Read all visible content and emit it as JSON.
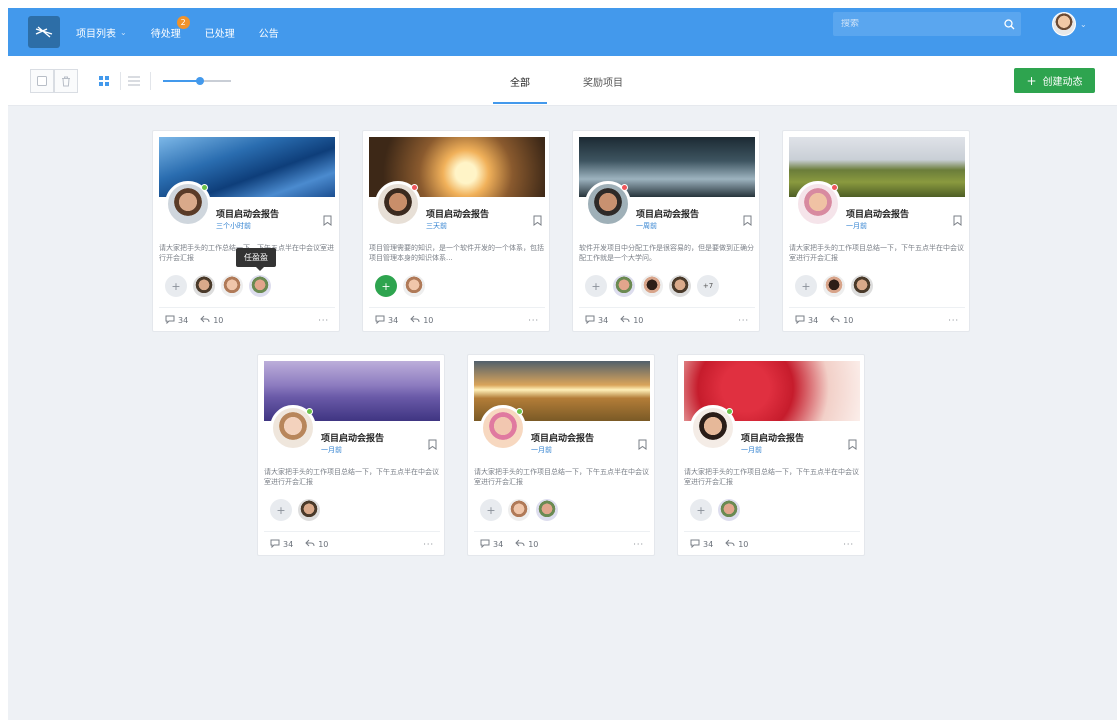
{
  "nav": {
    "items": [
      {
        "label": "项目列表",
        "caret": "⌄"
      },
      {
        "label": "待处理",
        "badge": "2"
      },
      {
        "label": "已处理"
      },
      {
        "label": "公告"
      }
    ],
    "search_placeholder": "搜索"
  },
  "toolbar": {
    "tabs": [
      {
        "label": "全部",
        "active": true
      },
      {
        "label": "奖励项目",
        "active": false
      }
    ],
    "slider_level": 0.55,
    "create_label": "创建动态",
    "create_plus": "+"
  },
  "colors": {
    "primary": "#4399ec",
    "green": "#2ea44f",
    "online": "#6cc24a",
    "busy": "#f0565b"
  },
  "cards": [
    {
      "title": "项目启动会报告",
      "time": "三个小时前",
      "desc": "请大家把手头的工作总结一下，下午五点半在中会议室进行开会汇报",
      "members": 3,
      "add_green": false,
      "comments": "34",
      "replies": "10",
      "more": "···",
      "status": "online"
    },
    {
      "title": "项目启动会报告",
      "time": "三天前",
      "desc": "项目管理需要的知识，是一个软件开发的一个体系，包括项目管理本身的知识体系...",
      "members": 1,
      "add_green": true,
      "comments": "34",
      "replies": "10",
      "more": "···",
      "status": "busy"
    },
    {
      "title": "项目启动会报告",
      "time": "一周前",
      "desc": "软件开发项目中分配工作是很容易的，但是要做到正确分配工作就是一个大学问。",
      "members": 3,
      "more_members": "+7",
      "add_green": false,
      "comments": "34",
      "replies": "10",
      "more": "···",
      "status": "busy"
    },
    {
      "title": "项目启动会报告",
      "time": "一月前",
      "desc": "请大家把手头的工作项目总结一下，下午五点半在中会议室进行开会汇报",
      "members": 2,
      "add_green": false,
      "comments": "34",
      "replies": "10",
      "more": "···",
      "status": "busy"
    },
    {
      "title": "项目启动会报告",
      "time": "一月前",
      "desc": "请大家把手头的工作项目总结一下，下午五点半在中会议室进行开会汇报",
      "members": 1,
      "add_green": false,
      "comments": "34",
      "replies": "10",
      "more": "···",
      "status": "online"
    },
    {
      "title": "项目启动会报告",
      "time": "一月前",
      "desc": "请大家把手头的工作项目总结一下，下午五点半在中会议室进行开会汇报",
      "members": 2,
      "add_green": false,
      "comments": "34",
      "replies": "10",
      "more": "···",
      "status": "online"
    },
    {
      "title": "项目启动会报告",
      "time": "一月前",
      "desc": "请大家把手头的工作项目总结一下，下午五点半在中会议室进行开会汇报",
      "members": 1,
      "add_green": false,
      "comments": "34",
      "replies": "10",
      "more": "···",
      "status": "online"
    }
  ],
  "tooltip": "任盈盈"
}
